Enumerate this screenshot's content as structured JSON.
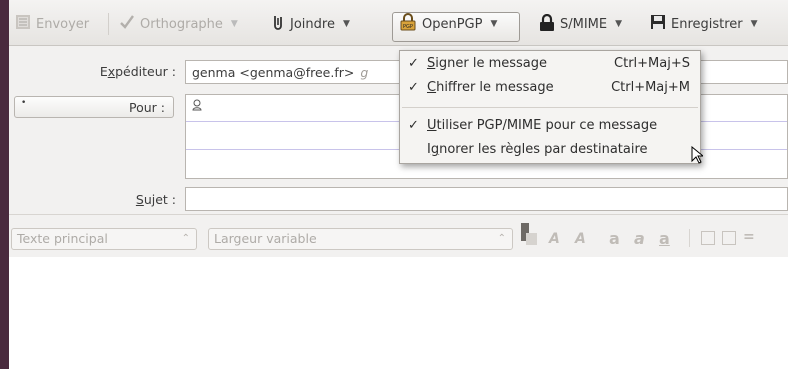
{
  "toolbar": {
    "send_label": "Envoyer",
    "spell_label": "Orthographe",
    "attach_label": "Joindre",
    "openpgp_label": "OpenPGP",
    "smime_label": "S/MIME",
    "save_label": "Enregistrer",
    "pgp_icon_text": "PGP"
  },
  "header": {
    "from_label_pre": "E",
    "from_label_u": "x",
    "from_label_post": "péditeur :",
    "from_value": "genma <genma@free.fr>",
    "from_hint": "g",
    "to_label": "Pour :",
    "subject_label_u": "S",
    "subject_label_post": "ujet :"
  },
  "format_bar": {
    "paragraph_format": "Texte principal",
    "font": "Largeur variable"
  },
  "openpgp_menu": {
    "items": [
      {
        "checked": true,
        "mnemonic": "S",
        "rest": "igner le message",
        "shortcut": "Ctrl+Maj+S"
      },
      {
        "checked": true,
        "mnemonic": "C",
        "rest": "hiffrer le message",
        "shortcut": "Ctrl+Maj+M"
      },
      {
        "checked": true,
        "mnemonic": "U",
        "rest": "tiliser PGP/MIME pour ce message",
        "shortcut": ""
      },
      {
        "checked": false,
        "pre": "I",
        "mnemonic": "g",
        "rest": "norer les règles par destinataire",
        "shortcut": ""
      }
    ]
  },
  "colors": {
    "window_bg": "#f2f1f0",
    "desktop": "#4a2a3e",
    "recipient_line": "#c8c3ea"
  }
}
